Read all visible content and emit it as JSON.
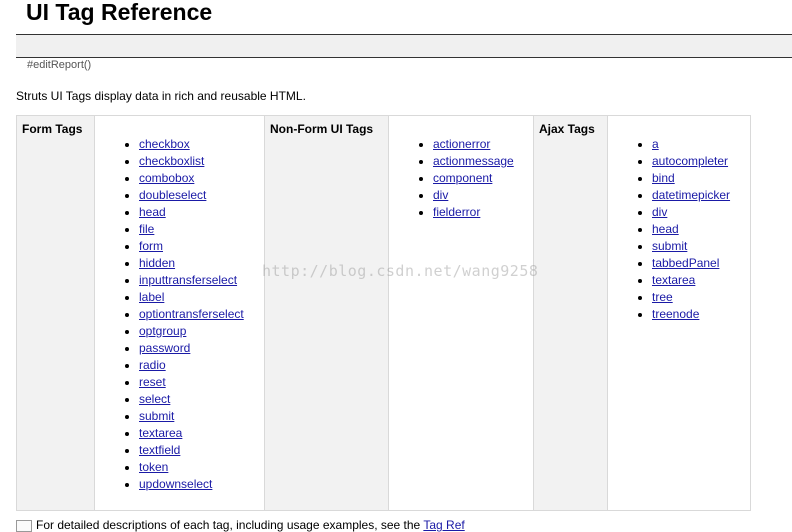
{
  "page": {
    "title": "UI Tag Reference",
    "anchor": "#editReport()",
    "intro": "Struts UI Tags display data in rich and reusable HTML.",
    "watermark": "http://blog.csdn.net/wang9258",
    "footer_text": "For detailed descriptions of each tag, including usage examples, see the",
    "footer_link": "Tag Ref"
  },
  "columns": [
    {
      "heading": "Form Tags",
      "items": [
        "checkbox",
        "checkboxlist",
        "combobox",
        "doubleselect",
        "head",
        "file",
        "form",
        "hidden",
        "inputtransferselect",
        "label",
        "optiontransferselect",
        "optgroup",
        "password",
        "radio",
        "reset",
        "select",
        "submit",
        "textarea",
        "textfield",
        "token",
        "updownselect"
      ]
    },
    {
      "heading": "Non-Form UI Tags",
      "items": [
        "actionerror",
        "actionmessage",
        "component",
        "div",
        "fielderror"
      ]
    },
    {
      "heading": "Ajax Tags",
      "items": [
        "a",
        "autocompleter",
        "bind",
        "datetimepicker",
        "div",
        "head",
        "submit",
        "tabbedPanel",
        "textarea",
        "tree",
        "treenode"
      ]
    }
  ]
}
